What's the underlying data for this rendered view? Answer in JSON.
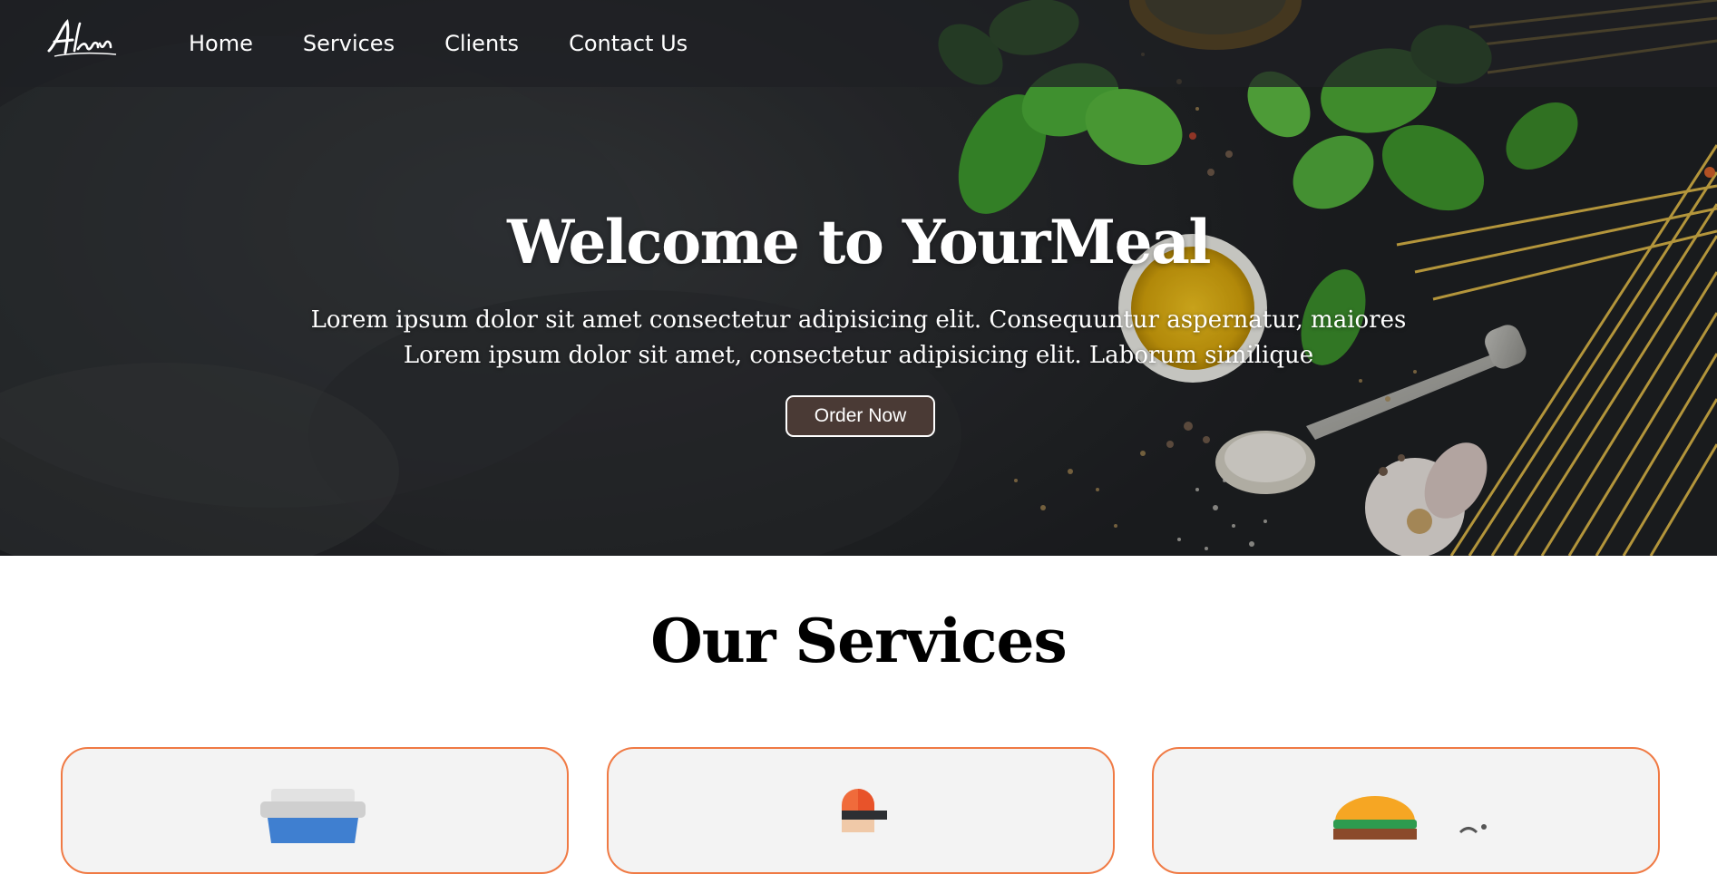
{
  "brand": {
    "logo_text": "Alan"
  },
  "nav": {
    "items": [
      {
        "label": "Home"
      },
      {
        "label": "Services"
      },
      {
        "label": "Clients"
      },
      {
        "label": "Contact Us"
      }
    ]
  },
  "hero": {
    "title": "Welcome to YourMeal",
    "subtitle_line1": "Lorem ipsum dolor sit amet consectetur adipisicing elit. Consequuntur aspernatur, maiores",
    "subtitle_line2": "Lorem ipsum dolor sit amet, consectetur adipisicing elit. Laborum similique",
    "cta_label": "Order Now"
  },
  "services": {
    "title": "Our Services",
    "cards": [
      {
        "icon": "coffee-cup-icon"
      },
      {
        "icon": "ice-cream-icon"
      },
      {
        "icon": "burger-icon"
      }
    ]
  },
  "colors": {
    "card_border": "#f07a44",
    "card_background": "#f3f3f3",
    "button_background": "#4a3a35",
    "nav_background": "#1e2024"
  }
}
